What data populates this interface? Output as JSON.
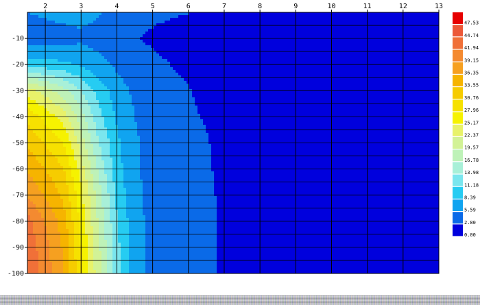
{
  "chart_data": {
    "type": "heatmap",
    "x_ticks": [
      "2",
      "3",
      "4",
      "5",
      "6",
      "7",
      "8",
      "9",
      "10",
      "11",
      "12",
      "13"
    ],
    "x_tick_values": [
      2,
      3,
      4,
      5,
      6,
      7,
      8,
      9,
      10,
      11,
      12,
      13
    ],
    "y_ticks": [
      "-10",
      "-20",
      "-30",
      "-40",
      "-50",
      "-60",
      "-70",
      "-80",
      "-90",
      "-100"
    ],
    "y_tick_values": [
      -10,
      -20,
      -30,
      -40,
      -50,
      -60,
      -70,
      -80,
      -90,
      -100
    ],
    "xlim": [
      1.5,
      13
    ],
    "ylim": [
      -100,
      0
    ],
    "grid": true,
    "colorbar": {
      "labels": [
        "47.53",
        "44.74",
        "41.94",
        "39.15",
        "36.35",
        "33.55",
        "30.76",
        "27.96",
        "25.17",
        "22.37",
        "19.57",
        "16.78",
        "13.98",
        "11.18",
        "8.39",
        "5.59",
        "2.80",
        "0.00"
      ],
      "levels": [
        0.0,
        2.8,
        5.59,
        8.39,
        11.18,
        13.98,
        16.78,
        19.57,
        22.37,
        25.17,
        27.96,
        30.76,
        33.55,
        36.35,
        39.15,
        41.94,
        44.74,
        47.53
      ],
      "colors": [
        "#0000dd",
        "#0a6ae8",
        "#10a4f0",
        "#26ccf2",
        "#7ae6ee",
        "#a8f0d8",
        "#bef2b8",
        "#d2f296",
        "#e8f26a",
        "#f6f200",
        "#f6e100",
        "#f6cc00",
        "#f6b400",
        "#f6a020",
        "#f48a30",
        "#f07038",
        "#ec5838",
        "#e60000"
      ]
    },
    "depths": [
      0,
      -10,
      -20,
      -30,
      -40,
      -50,
      -60,
      -70,
      -80,
      -90,
      -100
    ],
    "columns": [
      {
        "x": 1.5,
        "values": [
          5.59,
          4,
          10,
          24,
          30,
          33,
          36,
          39,
          43,
          44,
          44.8
        ]
      },
      {
        "x": 2.5,
        "values": [
          6.5,
          4.5,
          9,
          18,
          24,
          28,
          31,
          33,
          35,
          36,
          36.5
        ]
      },
      {
        "x": 3.0,
        "values": [
          6.6,
          5,
          8,
          14,
          18,
          21,
          24,
          26,
          27,
          28,
          28.5
        ]
      },
      {
        "x": 3.5,
        "values": [
          5.8,
          4.5,
          6.5,
          10,
          12,
          14,
          16,
          18,
          19,
          20,
          20.5
        ]
      },
      {
        "x": 4.0,
        "values": [
          4.5,
          3.2,
          5,
          7,
          8,
          9,
          9.5,
          10.5,
          11.5,
          12,
          12.5
        ]
      },
      {
        "x": 4.5,
        "values": [
          3.5,
          2.9,
          3.8,
          5,
          5.6,
          6,
          6,
          6.2,
          6.4,
          6.5,
          6.6
        ]
      },
      {
        "x": 5.0,
        "values": [
          3.2,
          2.5,
          3.2,
          4,
          4.4,
          4.6,
          4.7,
          4.8,
          4.9,
          5,
          5
        ]
      },
      {
        "x": 5.5,
        "values": [
          3.0,
          2.2,
          2.8,
          3.4,
          3.7,
          3.9,
          4,
          4.1,
          4.2,
          4.2,
          4.3
        ]
      },
      {
        "x": 6.0,
        "values": [
          2.9,
          1.8,
          2.2,
          3.0,
          3.2,
          3.4,
          3.5,
          3.6,
          3.6,
          3.7,
          3.7
        ]
      },
      {
        "x": 6.5,
        "values": [
          2.3,
          1.0,
          1.4,
          2.0,
          2.6,
          3.0,
          3.1,
          3.2,
          3.2,
          3.2,
          3.2
        ]
      },
      {
        "x": 7.0,
        "values": [
          1.5,
          0.5,
          0.8,
          1.2,
          1.6,
          2.0,
          2.2,
          2.4,
          2.5,
          2.5,
          2.5
        ]
      },
      {
        "x": 8.0,
        "values": [
          0.5,
          0.3,
          0.4,
          0.5,
          0.7,
          0.9,
          1.0,
          1.1,
          1.2,
          1.2,
          1.2
        ]
      },
      {
        "x": 13.0,
        "values": [
          0.2,
          0.1,
          0.1,
          0.2,
          0.2,
          0.2,
          0.2,
          0.2,
          0.2,
          0.2,
          0.2
        ]
      }
    ]
  }
}
